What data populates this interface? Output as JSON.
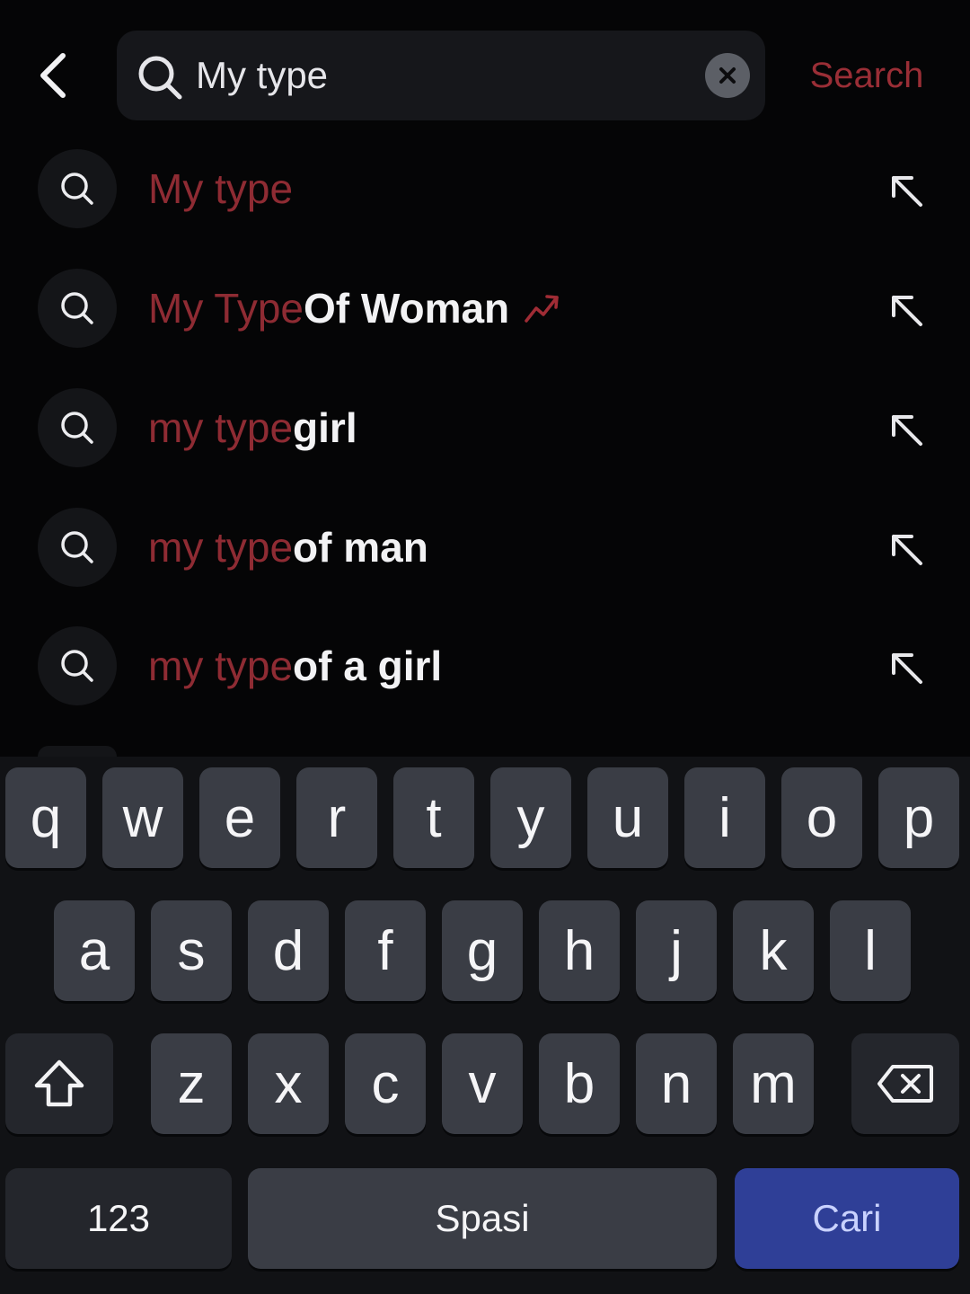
{
  "header": {
    "query": "My type",
    "search_label": "Search",
    "back_icon": "chevron-left-icon",
    "clear_icon": "close-circle-icon"
  },
  "suggestions": [
    {
      "match": "My type",
      "rest": "",
      "trending": false
    },
    {
      "match": "My Type",
      "rest": " Of Woman",
      "trending": true
    },
    {
      "match": "my type",
      "rest": " girl",
      "trending": false
    },
    {
      "match": "my type",
      "rest": " of man",
      "trending": false
    },
    {
      "match": "my type",
      "rest": " of a girl",
      "trending": false
    }
  ],
  "keyboard": {
    "row1": [
      "q",
      "w",
      "e",
      "r",
      "t",
      "y",
      "u",
      "i",
      "o",
      "p"
    ],
    "row2": [
      "a",
      "s",
      "d",
      "f",
      "g",
      "h",
      "j",
      "k",
      "l"
    ],
    "row3": [
      "z",
      "x",
      "c",
      "v",
      "b",
      "n",
      "m"
    ],
    "numbers_label": "123",
    "space_label": "Spasi",
    "search_key_label": "Cari"
  },
  "colors": {
    "accent": "#9a2e36",
    "match_text": "#8e2b33",
    "background": "#050506",
    "key": "#3a3d45",
    "cari_key": "#2f3f97"
  }
}
